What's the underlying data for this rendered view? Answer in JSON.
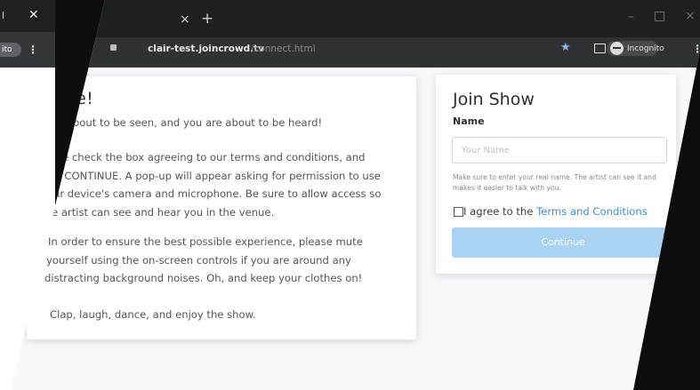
{
  "left_window": {
    "close_glyph": "✕",
    "tab_title": "l",
    "incognito_badge": "ito",
    "menu_glyph": "⋮"
  },
  "browser": {
    "tab_close_glyph": "×",
    "new_tab_glyph": "+",
    "window_minimize_glyph": "–",
    "window_close_glyph": "×",
    "url_host": "clair-test.joincrowd.tv",
    "url_path": "/connect.html",
    "star_icon_glyph": "★",
    "incognito_label": "Incognito",
    "menu_glyph": "⋮"
  },
  "welcome": {
    "title": "come!",
    "paragraph1": "e about to be seen, and you are about to be heard!",
    "paragraph2_lines": [
      "se check the box agreeing to our terms and conditions, and",
      "k CONTINUE. A pop-up will appear asking for permission to use",
      "ur device's camera and microphone. Be sure to allow access so",
      "e artist can see and hear you in the venue."
    ],
    "paragraph3_lines": [
      "In order to ensure the best possible experience, please mute",
      "yourself using the on-screen controls if you are around any",
      "distracting background noises. Oh, and keep your clothes on!"
    ],
    "paragraph4": "Clap, laugh, dance, and enjoy the show."
  },
  "join": {
    "title": "Join Show",
    "name_label": "Name",
    "name_placeholder": "Your Name",
    "name_value": "",
    "help_text": "Make sure to enter your real name. The artist can see it and makes it easier to talk with you.",
    "agree_prefix": "I agree to the ",
    "terms_link": "Terms and Conditions",
    "continue_label": "Continue"
  },
  "colors": {
    "accent_link": "#3a8fd8",
    "continue_bg": "#a9d2f3",
    "chrome_dark": "#1e1f23"
  }
}
